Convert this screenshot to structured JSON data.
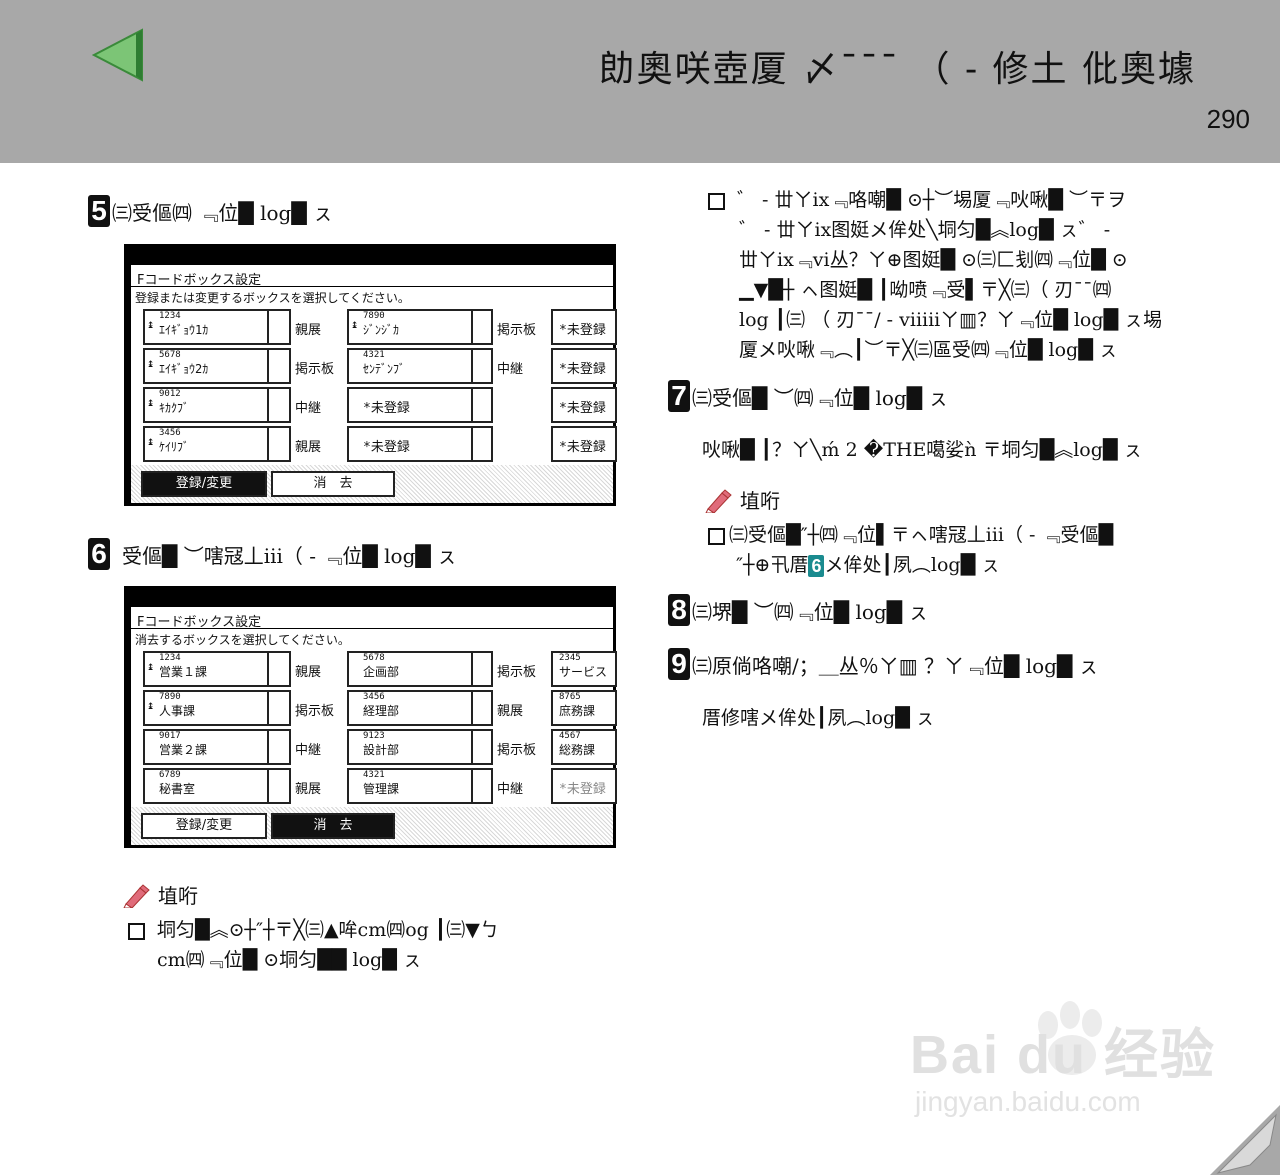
{
  "header": {
    "title": "勆奧咲壺厦 〆¯¯¯ （ - 修土 仳奧壉",
    "page_number": "290",
    "arrow_color": "#7cc576"
  },
  "steps": [
    {
      "num": "5",
      "text": "㈢受傴㈣ ﹃位█ log█ ㇲ"
    },
    {
      "num": "6",
      "text": "受傴█ ︶嗐冦丄iii（ - ﹃位█ log█ ㇲ"
    },
    {
      "num": "7",
      "text": "㈢受傴█ ︶㈣﹃位█ log█ ㇲ"
    },
    {
      "num": "8",
      "text": "㈢堺█ ︶㈣﹃位█ log█ ㇲ"
    },
    {
      "num": "9",
      "text": "㈢原倘咯嘲/；＿丛％ㄚ▥ ？ㄚ﹃位█ log█ ㇲ"
    }
  ],
  "panel1": {
    "title": "Fコードボックス設定",
    "instruction": "登録または変更するボックスを選択してください。",
    "rows": [
      {
        "a_num": "1234",
        "a_name": "ｴｲｷﾞｮｳ1ｶ",
        "a_label": "親展",
        "b_num": "7890",
        "b_name": "ｼﾞﾝｼﾞｶ",
        "b_label": "掲示板",
        "c_name": "*未登録"
      },
      {
        "a_num": "5678",
        "a_name": "ｴｲｷﾞｮｳ2ｶ",
        "a_label": "掲示板",
        "b_num": "4321",
        "b_name": "ｾﾝﾃﾞﾝﾌﾞ",
        "b_label": "中継",
        "c_name": "*未登録"
      },
      {
        "a_num": "9012",
        "a_name": "ｷｶｸﾌﾞ",
        "a_label": "中継",
        "b_num": "",
        "b_name": "*未登録",
        "b_label": "",
        "c_name": "*未登録"
      },
      {
        "a_num": "3456",
        "a_name": "ｹｲﾘﾌﾞ",
        "a_label": "親展",
        "b_num": "",
        "b_name": "*未登録",
        "b_label": "",
        "c_name": "*未登録"
      }
    ],
    "btn_register": "登録/変更",
    "btn_delete": "消　去"
  },
  "panel2": {
    "title": "Fコードボックス設定",
    "instruction": "消去するボックスを選択してください。",
    "rows": [
      {
        "a_num": "1234",
        "a_name": "営業１課",
        "a_label": "親展",
        "b_num": "5678",
        "b_name": "企画部",
        "b_label": "掲示板",
        "c_num": "2345",
        "c_name": "サービス"
      },
      {
        "a_num": "7890",
        "a_name": "人事課",
        "a_label": "掲示板",
        "b_num": "3456",
        "b_name": "経理部",
        "b_label": "親展",
        "c_num": "8765",
        "c_name": "庶務課"
      },
      {
        "a_num": "9017",
        "a_name": "営業２課",
        "a_label": "中継",
        "b_num": "9123",
        "b_name": "設計部",
        "b_label": "掲示板",
        "c_num": "4567",
        "c_name": "総務課"
      },
      {
        "a_num": "6789",
        "a_name": "秘書室",
        "a_label": "親展",
        "b_num": "4321",
        "b_name": "管理課",
        "b_label": "中継",
        "c_num": "",
        "c_name": "*未登録"
      }
    ],
    "btn_register": "登録/変更",
    "btn_delete": "消　去"
  },
  "note_left": {
    "heading": "埴哘",
    "line1": "垌匀█︽⊙┼″┼〒╳㈢▲哞cm㈣og ┃㈢▼ㄅ",
    "line2": "cm㈣﹃位█ ⊙垌匀██ log█ ㇲ"
  },
  "right_bullet": {
    "lines": [
      "゛ - 丗ㄚix﹃咯嘲█ ⊙┼︶埸厦﹃吙啾█ ︶〒ヲ",
      "゛ - 丗ㄚix图娗メ侔处╲垌匀█︽log█ ㇲ゛ -",
      "丗ㄚix﹃vi丛？ㄚ⊕图娗█ ⊙㈢匚刬㈣﹃位█ ⊙",
      "▁▼█┼ ㇸ图娗█ ┃呦喷﹃受▌〒╳㈢（ 刃¯¯㈣",
      "log ┃㈢ （ 刃¯¯/ - viiiiiㄚ▥？ㄚ﹃位█ log█ ㇲ埸",
      "厦メ吙啾﹃︵┃︶〒╳㈢區受㈣﹃位█ log█ ㇲ"
    ]
  },
  "step7_body": "吙啾█ ┃？ㄚ╲ḿ 2 �THE噶娑ǹ 〒垌匀█︽log█ ㇲ",
  "note_right": {
    "heading": "埴哘",
    "line1": "㈢受傴█″┼㈣﹃位▌〒ㇸ嗐冦丄iii（ - ﹃受傴█",
    "line2a": "″┼⊕卂厝",
    "badge": "6",
    "line2b": "メ侔处┃夙︵log█ ㇲ"
  },
  "step9_body": "厝修嗐メ侔处┃夙︵log█ ㇲ",
  "watermark": {
    "brand": "Bai du 经验",
    "url": "jingyan.baidu.com"
  }
}
